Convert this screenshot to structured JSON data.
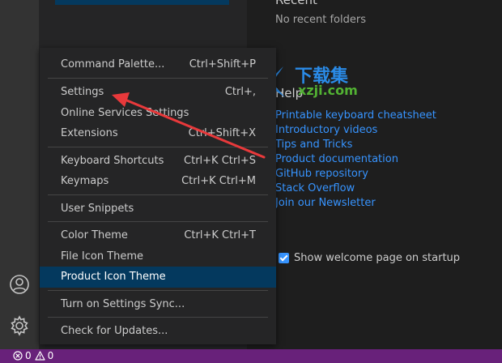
{
  "welcome": {
    "recent_title": "Recent",
    "no_recent": "No recent folders",
    "help_title": "Help",
    "help_links": [
      "Printable keyboard cheatsheet",
      "Introductory videos",
      "Tips and Tricks",
      "Product documentation",
      "GitHub repository",
      "Stack Overflow",
      "Join our Newsletter"
    ],
    "show_welcome_label": "Show welcome page on startup"
  },
  "manage_menu": {
    "items": [
      {
        "label": "Command Palette...",
        "shortcut": "Ctrl+Shift+P"
      },
      {
        "label": "Settings",
        "shortcut": "Ctrl+,"
      },
      {
        "label": "Online Services Settings",
        "shortcut": ""
      },
      {
        "label": "Extensions",
        "shortcut": "Ctrl+Shift+X"
      },
      {
        "label": "Keyboard Shortcuts",
        "shortcut": "Ctrl+K Ctrl+S"
      },
      {
        "label": "Keymaps",
        "shortcut": "Ctrl+K Ctrl+M"
      },
      {
        "label": "User Snippets",
        "shortcut": ""
      },
      {
        "label": "Color Theme",
        "shortcut": "Ctrl+K Ctrl+T"
      },
      {
        "label": "File Icon Theme",
        "shortcut": ""
      },
      {
        "label": "Product Icon Theme",
        "shortcut": ""
      },
      {
        "label": "Turn on Settings Sync...",
        "shortcut": ""
      },
      {
        "label": "Check for Updates...",
        "shortcut": ""
      }
    ]
  },
  "activity_bar": {
    "icons": [
      "account-icon",
      "gear-icon"
    ]
  },
  "status_bar": {
    "errors": "0",
    "warnings": "0"
  },
  "watermark": {
    "top_text": "下载集",
    "bottom_text": "xzji.com"
  },
  "colors": {
    "status_bar": "#68217a",
    "link": "#3794ff",
    "menu_active": "#04395e",
    "annotation_arrow": "#e8393b"
  }
}
